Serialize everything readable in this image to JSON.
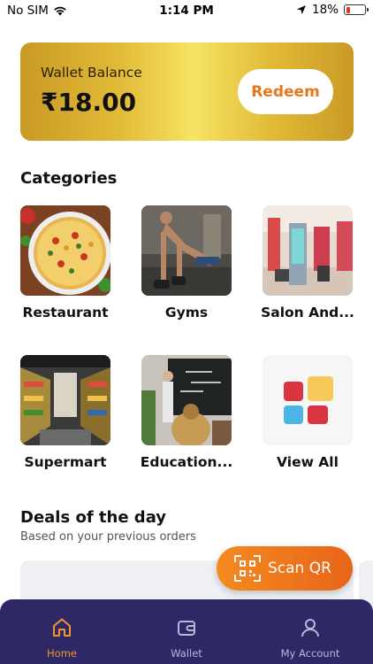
{
  "status_bar": {
    "carrier": "No SIM",
    "time": "1:14 PM",
    "battery": "18%",
    "battery_level": 0.18
  },
  "wallet": {
    "label": "Wallet Balance",
    "amount": "₹18.00",
    "redeem_label": "Redeem"
  },
  "categories": {
    "title": "Categories",
    "items": [
      {
        "label": "Restaurant"
      },
      {
        "label": "Gyms"
      },
      {
        "label": "Salon And..."
      },
      {
        "label": "Supermart"
      },
      {
        "label": "Education..."
      },
      {
        "label": "View All"
      }
    ]
  },
  "deals": {
    "title": "Deals of the day",
    "subtitle": "Based on your previous orders"
  },
  "scan_qr": {
    "label": "Scan QR"
  },
  "bottom_nav": {
    "items": [
      {
        "label": "Home",
        "icon": "home-icon"
      },
      {
        "label": "Wallet",
        "icon": "wallet-icon"
      },
      {
        "label": "My Account",
        "icon": "user-icon"
      }
    ],
    "active_color": "#f29630",
    "background": "#2e2866"
  },
  "colors": {
    "accent": "#e8771c",
    "gold": "#e2bb38"
  }
}
